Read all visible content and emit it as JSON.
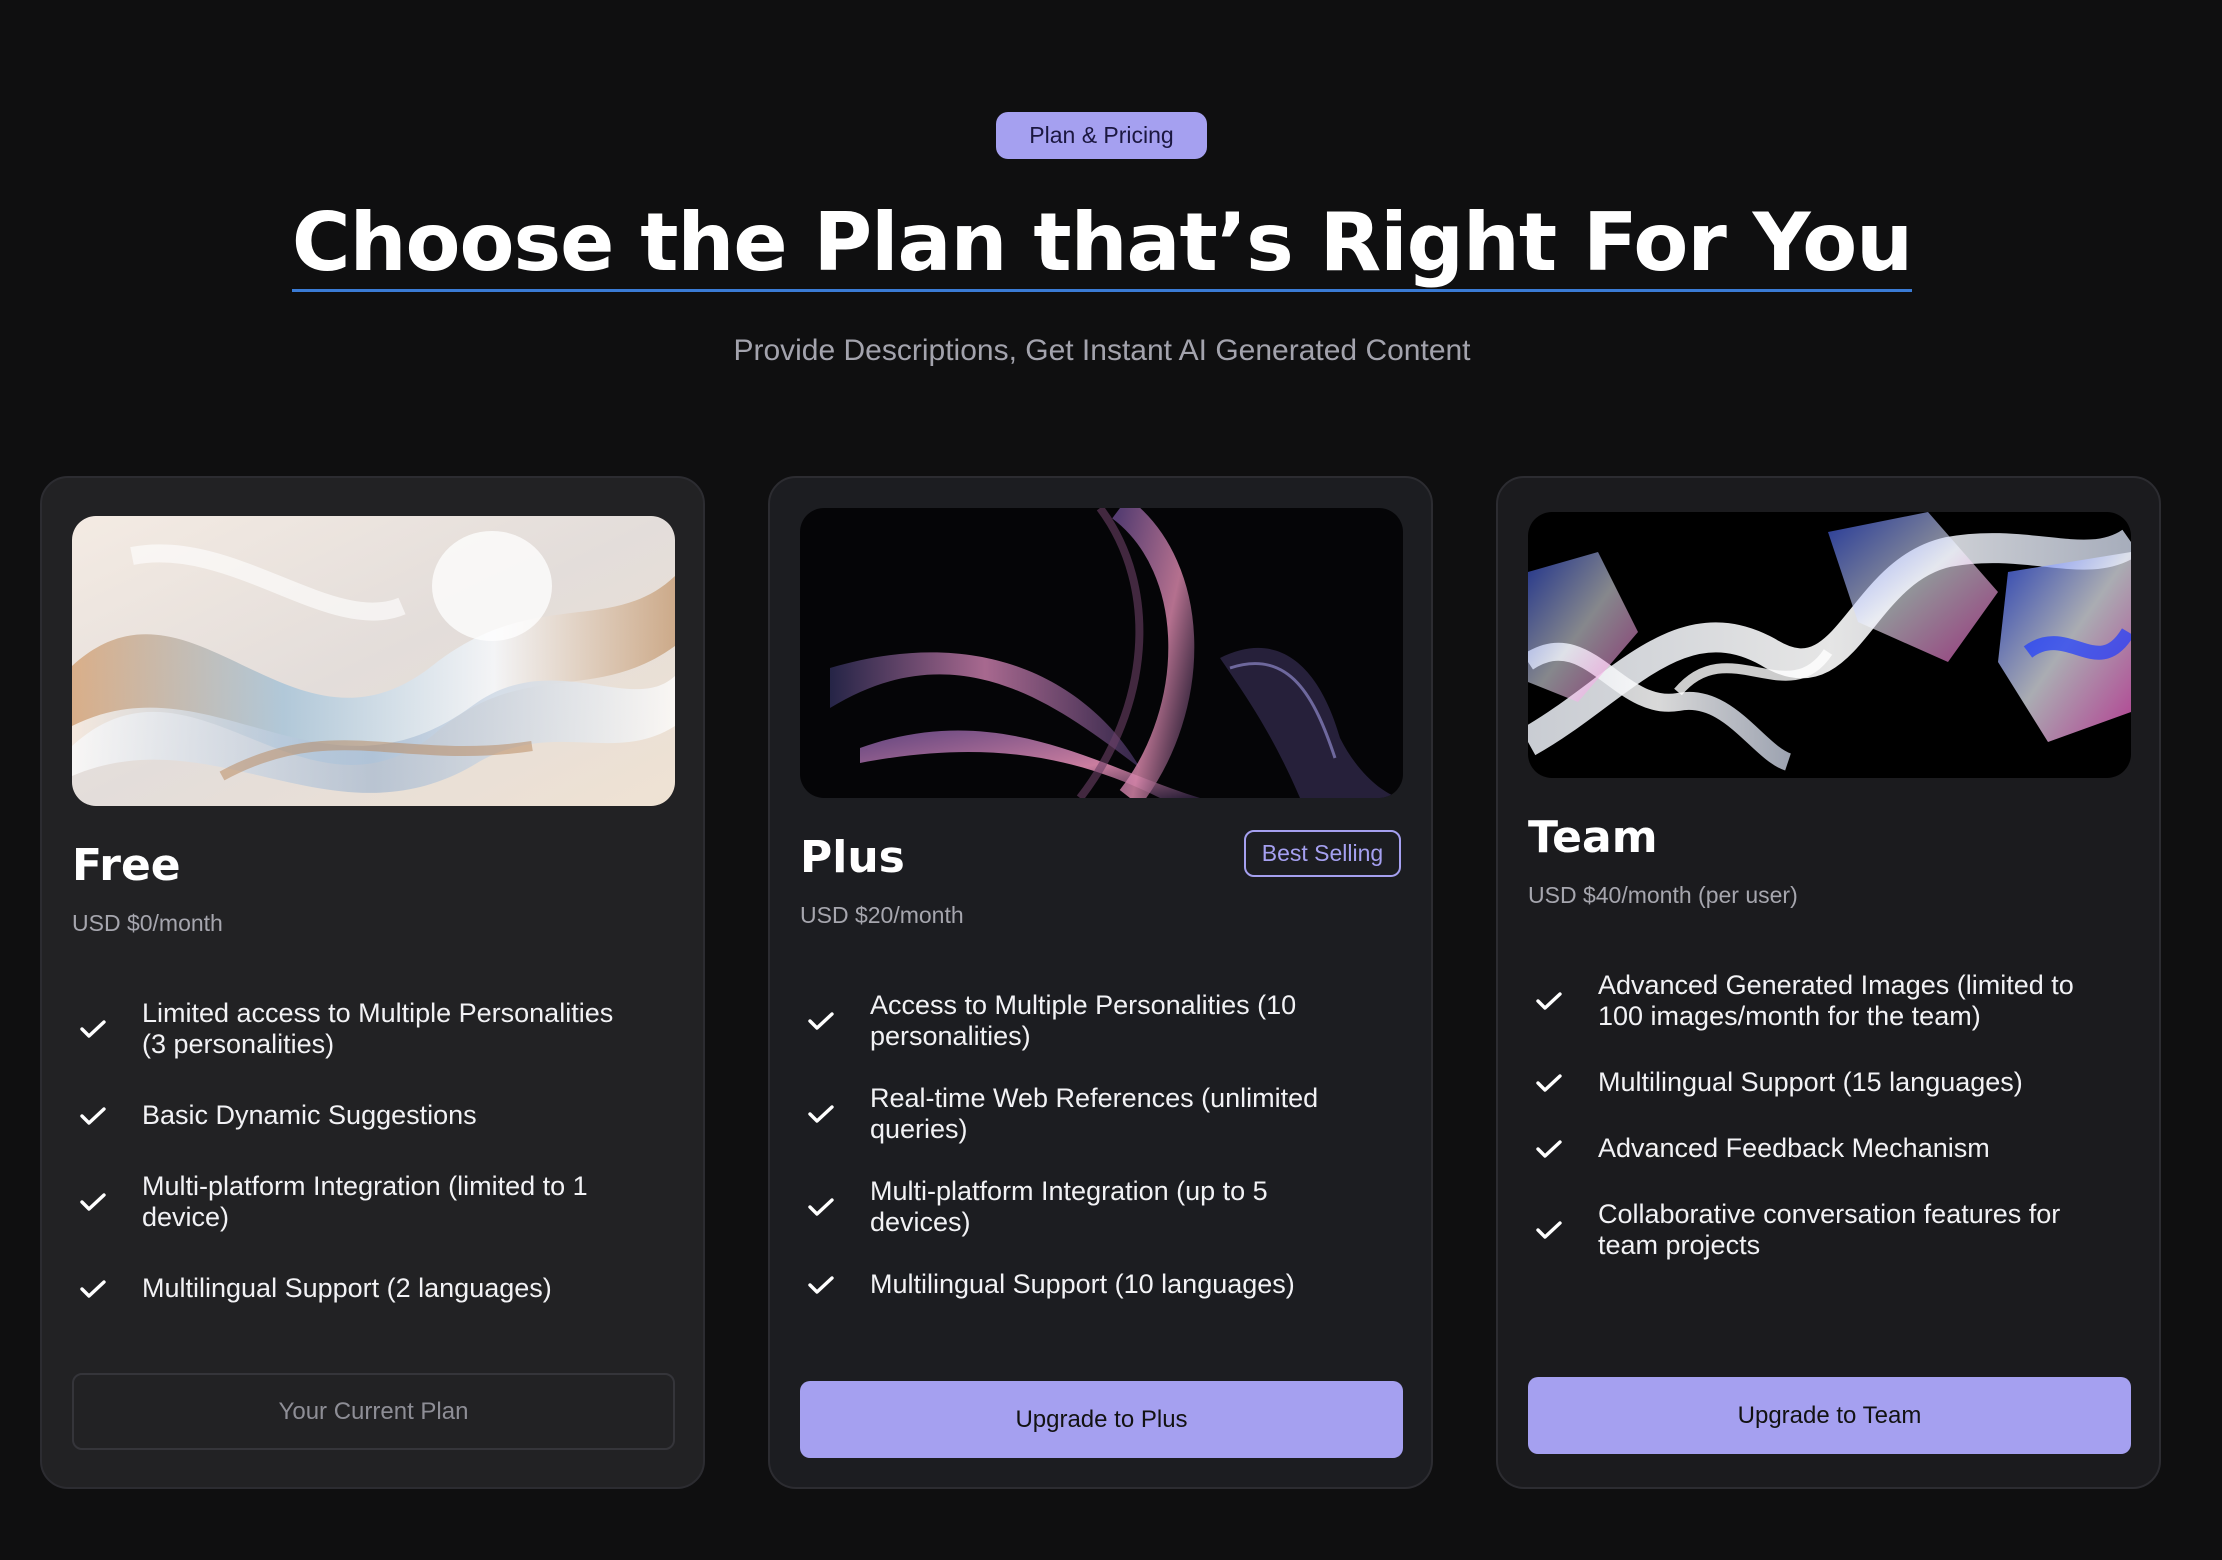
{
  "header": {
    "badge": "Plan & Pricing",
    "title": "Choose the Plan that’s Right For You",
    "subtitle": "Provide Descriptions, Get Instant AI Generated Content"
  },
  "plans": [
    {
      "name": "Free",
      "price": "USD $0/month",
      "features": [
        "Limited access to Multiple Personalities (3 personalities)",
        "Basic Dynamic Suggestions",
        "Multi-platform Integration (limited to 1 device)",
        "Multilingual Support (2 languages)"
      ],
      "button": "Your Current Plan"
    },
    {
      "name": "Plus",
      "price": "USD $20/month",
      "tag": "Best Selling",
      "features": [
        "Access to Multiple Personalities (10 personalities)",
        "Real-time Web References (unlimited queries)",
        "Multi-platform Integration (up to 5 devices)",
        "Multilingual Support (10 languages)"
      ],
      "button": "Upgrade to Plus"
    },
    {
      "name": "Team",
      "price": "USD $40/month (per user)",
      "features": [
        "Advanced Generated Images (limited to 100 images/month for the team)",
        "Multilingual Support (15 languages)",
        "Advanced Feedback Mechanism",
        "Collaborative conversation features for team projects"
      ],
      "button": "Upgrade to Team"
    }
  ],
  "icons": {
    "check": "check-icon"
  },
  "colors": {
    "background": "#0f0f10",
    "accent": "#a5a0f0",
    "card": "#1d1d20"
  }
}
